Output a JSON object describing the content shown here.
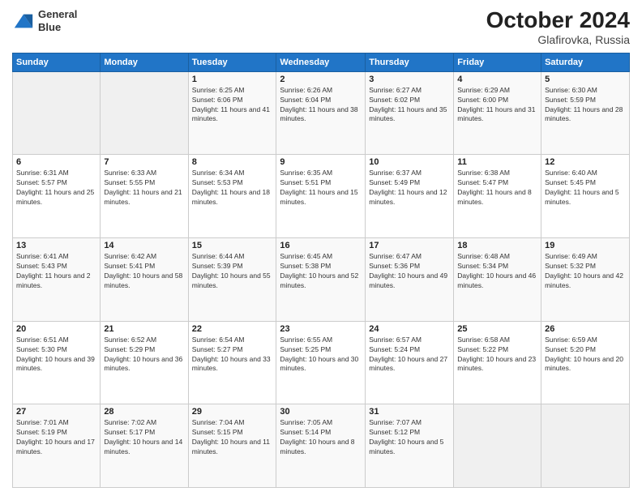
{
  "logo": {
    "line1": "General",
    "line2": "Blue"
  },
  "header": {
    "monthYear": "October 2024",
    "location": "Glafirovka, Russia"
  },
  "columns": [
    "Sunday",
    "Monday",
    "Tuesday",
    "Wednesday",
    "Thursday",
    "Friday",
    "Saturday"
  ],
  "weeks": [
    [
      {
        "day": "",
        "info": ""
      },
      {
        "day": "",
        "info": ""
      },
      {
        "day": "1",
        "info": "Sunrise: 6:25 AM\nSunset: 6:06 PM\nDaylight: 11 hours and 41 minutes."
      },
      {
        "day": "2",
        "info": "Sunrise: 6:26 AM\nSunset: 6:04 PM\nDaylight: 11 hours and 38 minutes."
      },
      {
        "day": "3",
        "info": "Sunrise: 6:27 AM\nSunset: 6:02 PM\nDaylight: 11 hours and 35 minutes."
      },
      {
        "day": "4",
        "info": "Sunrise: 6:29 AM\nSunset: 6:00 PM\nDaylight: 11 hours and 31 minutes."
      },
      {
        "day": "5",
        "info": "Sunrise: 6:30 AM\nSunset: 5:59 PM\nDaylight: 11 hours and 28 minutes."
      }
    ],
    [
      {
        "day": "6",
        "info": "Sunrise: 6:31 AM\nSunset: 5:57 PM\nDaylight: 11 hours and 25 minutes."
      },
      {
        "day": "7",
        "info": "Sunrise: 6:33 AM\nSunset: 5:55 PM\nDaylight: 11 hours and 21 minutes."
      },
      {
        "day": "8",
        "info": "Sunrise: 6:34 AM\nSunset: 5:53 PM\nDaylight: 11 hours and 18 minutes."
      },
      {
        "day": "9",
        "info": "Sunrise: 6:35 AM\nSunset: 5:51 PM\nDaylight: 11 hours and 15 minutes."
      },
      {
        "day": "10",
        "info": "Sunrise: 6:37 AM\nSunset: 5:49 PM\nDaylight: 11 hours and 12 minutes."
      },
      {
        "day": "11",
        "info": "Sunrise: 6:38 AM\nSunset: 5:47 PM\nDaylight: 11 hours and 8 minutes."
      },
      {
        "day": "12",
        "info": "Sunrise: 6:40 AM\nSunset: 5:45 PM\nDaylight: 11 hours and 5 minutes."
      }
    ],
    [
      {
        "day": "13",
        "info": "Sunrise: 6:41 AM\nSunset: 5:43 PM\nDaylight: 11 hours and 2 minutes."
      },
      {
        "day": "14",
        "info": "Sunrise: 6:42 AM\nSunset: 5:41 PM\nDaylight: 10 hours and 58 minutes."
      },
      {
        "day": "15",
        "info": "Sunrise: 6:44 AM\nSunset: 5:39 PM\nDaylight: 10 hours and 55 minutes."
      },
      {
        "day": "16",
        "info": "Sunrise: 6:45 AM\nSunset: 5:38 PM\nDaylight: 10 hours and 52 minutes."
      },
      {
        "day": "17",
        "info": "Sunrise: 6:47 AM\nSunset: 5:36 PM\nDaylight: 10 hours and 49 minutes."
      },
      {
        "day": "18",
        "info": "Sunrise: 6:48 AM\nSunset: 5:34 PM\nDaylight: 10 hours and 46 minutes."
      },
      {
        "day": "19",
        "info": "Sunrise: 6:49 AM\nSunset: 5:32 PM\nDaylight: 10 hours and 42 minutes."
      }
    ],
    [
      {
        "day": "20",
        "info": "Sunrise: 6:51 AM\nSunset: 5:30 PM\nDaylight: 10 hours and 39 minutes."
      },
      {
        "day": "21",
        "info": "Sunrise: 6:52 AM\nSunset: 5:29 PM\nDaylight: 10 hours and 36 minutes."
      },
      {
        "day": "22",
        "info": "Sunrise: 6:54 AM\nSunset: 5:27 PM\nDaylight: 10 hours and 33 minutes."
      },
      {
        "day": "23",
        "info": "Sunrise: 6:55 AM\nSunset: 5:25 PM\nDaylight: 10 hours and 30 minutes."
      },
      {
        "day": "24",
        "info": "Sunrise: 6:57 AM\nSunset: 5:24 PM\nDaylight: 10 hours and 27 minutes."
      },
      {
        "day": "25",
        "info": "Sunrise: 6:58 AM\nSunset: 5:22 PM\nDaylight: 10 hours and 23 minutes."
      },
      {
        "day": "26",
        "info": "Sunrise: 6:59 AM\nSunset: 5:20 PM\nDaylight: 10 hours and 20 minutes."
      }
    ],
    [
      {
        "day": "27",
        "info": "Sunrise: 7:01 AM\nSunset: 5:19 PM\nDaylight: 10 hours and 17 minutes."
      },
      {
        "day": "28",
        "info": "Sunrise: 7:02 AM\nSunset: 5:17 PM\nDaylight: 10 hours and 14 minutes."
      },
      {
        "day": "29",
        "info": "Sunrise: 7:04 AM\nSunset: 5:15 PM\nDaylight: 10 hours and 11 minutes."
      },
      {
        "day": "30",
        "info": "Sunrise: 7:05 AM\nSunset: 5:14 PM\nDaylight: 10 hours and 8 minutes."
      },
      {
        "day": "31",
        "info": "Sunrise: 7:07 AM\nSunset: 5:12 PM\nDaylight: 10 hours and 5 minutes."
      },
      {
        "day": "",
        "info": ""
      },
      {
        "day": "",
        "info": ""
      }
    ]
  ]
}
